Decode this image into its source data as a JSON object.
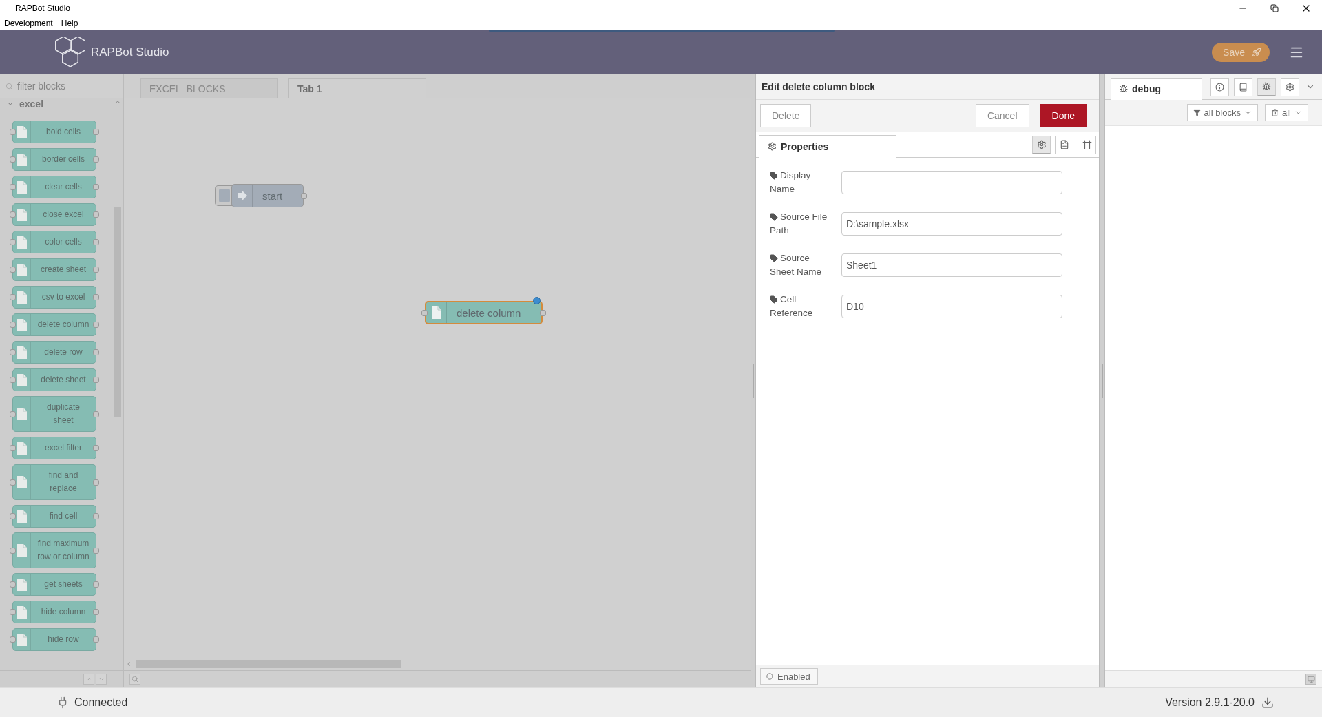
{
  "window": {
    "title": "RAPBot Studio"
  },
  "menu": [
    "Development",
    "Help"
  ],
  "header": {
    "brand": "RAPBot Studio",
    "save": "Save"
  },
  "palette": {
    "filter_placeholder": "filter blocks",
    "category": "excel",
    "blocks": [
      {
        "label": "bold cells"
      },
      {
        "label": "border cells"
      },
      {
        "label": "clear cells"
      },
      {
        "label": "close excel"
      },
      {
        "label": "color cells"
      },
      {
        "label": "create sheet"
      },
      {
        "label": "csv to excel"
      },
      {
        "label": "delete column"
      },
      {
        "label": "delete row"
      },
      {
        "label": "delete sheet"
      },
      {
        "label": "duplicate sheet"
      },
      {
        "label": "excel filter"
      },
      {
        "label": "find and replace"
      },
      {
        "label": "find cell"
      },
      {
        "label": "find maximum row or column"
      },
      {
        "label": "get sheets"
      },
      {
        "label": "hide column"
      },
      {
        "label": "hide row"
      }
    ]
  },
  "workspace_tabs": [
    {
      "label": "EXCEL_BLOCKS",
      "selected": false
    },
    {
      "label": "Tab 1",
      "selected": true
    }
  ],
  "canvas": {
    "nodes": [
      {
        "kind": "inject",
        "label": "start",
        "selected": false,
        "changed": false
      },
      {
        "kind": "file",
        "label": "delete column",
        "selected": true,
        "changed": true
      }
    ]
  },
  "editor": {
    "title": "Edit delete column block",
    "delete": "Delete",
    "cancel": "Cancel",
    "done": "Done",
    "tab": "Properties",
    "tools": [
      {
        "kind": "settings",
        "selected": true
      },
      {
        "kind": "description",
        "selected": false
      },
      {
        "kind": "appearance",
        "selected": false
      }
    ],
    "fields": [
      {
        "label": "Display Name"
      },
      {
        "label": "Source File Path",
        "value": "D:\\sample.xlsx"
      },
      {
        "label": "Source Sheet Name",
        "value": "Sheet1"
      },
      {
        "label": "Cell Reference",
        "value": "D10"
      }
    ],
    "enabled": "Enabled"
  },
  "sidebar": {
    "tab": "debug",
    "tools": [
      {
        "kind": "info",
        "selected": false
      },
      {
        "kind": "help",
        "selected": false
      },
      {
        "kind": "debug",
        "selected": true
      },
      {
        "kind": "config",
        "selected": false
      }
    ],
    "filter": "all blocks",
    "clear": "all"
  },
  "status": {
    "connection": "Connected",
    "version": "Version 2.9.1-20.0"
  }
}
